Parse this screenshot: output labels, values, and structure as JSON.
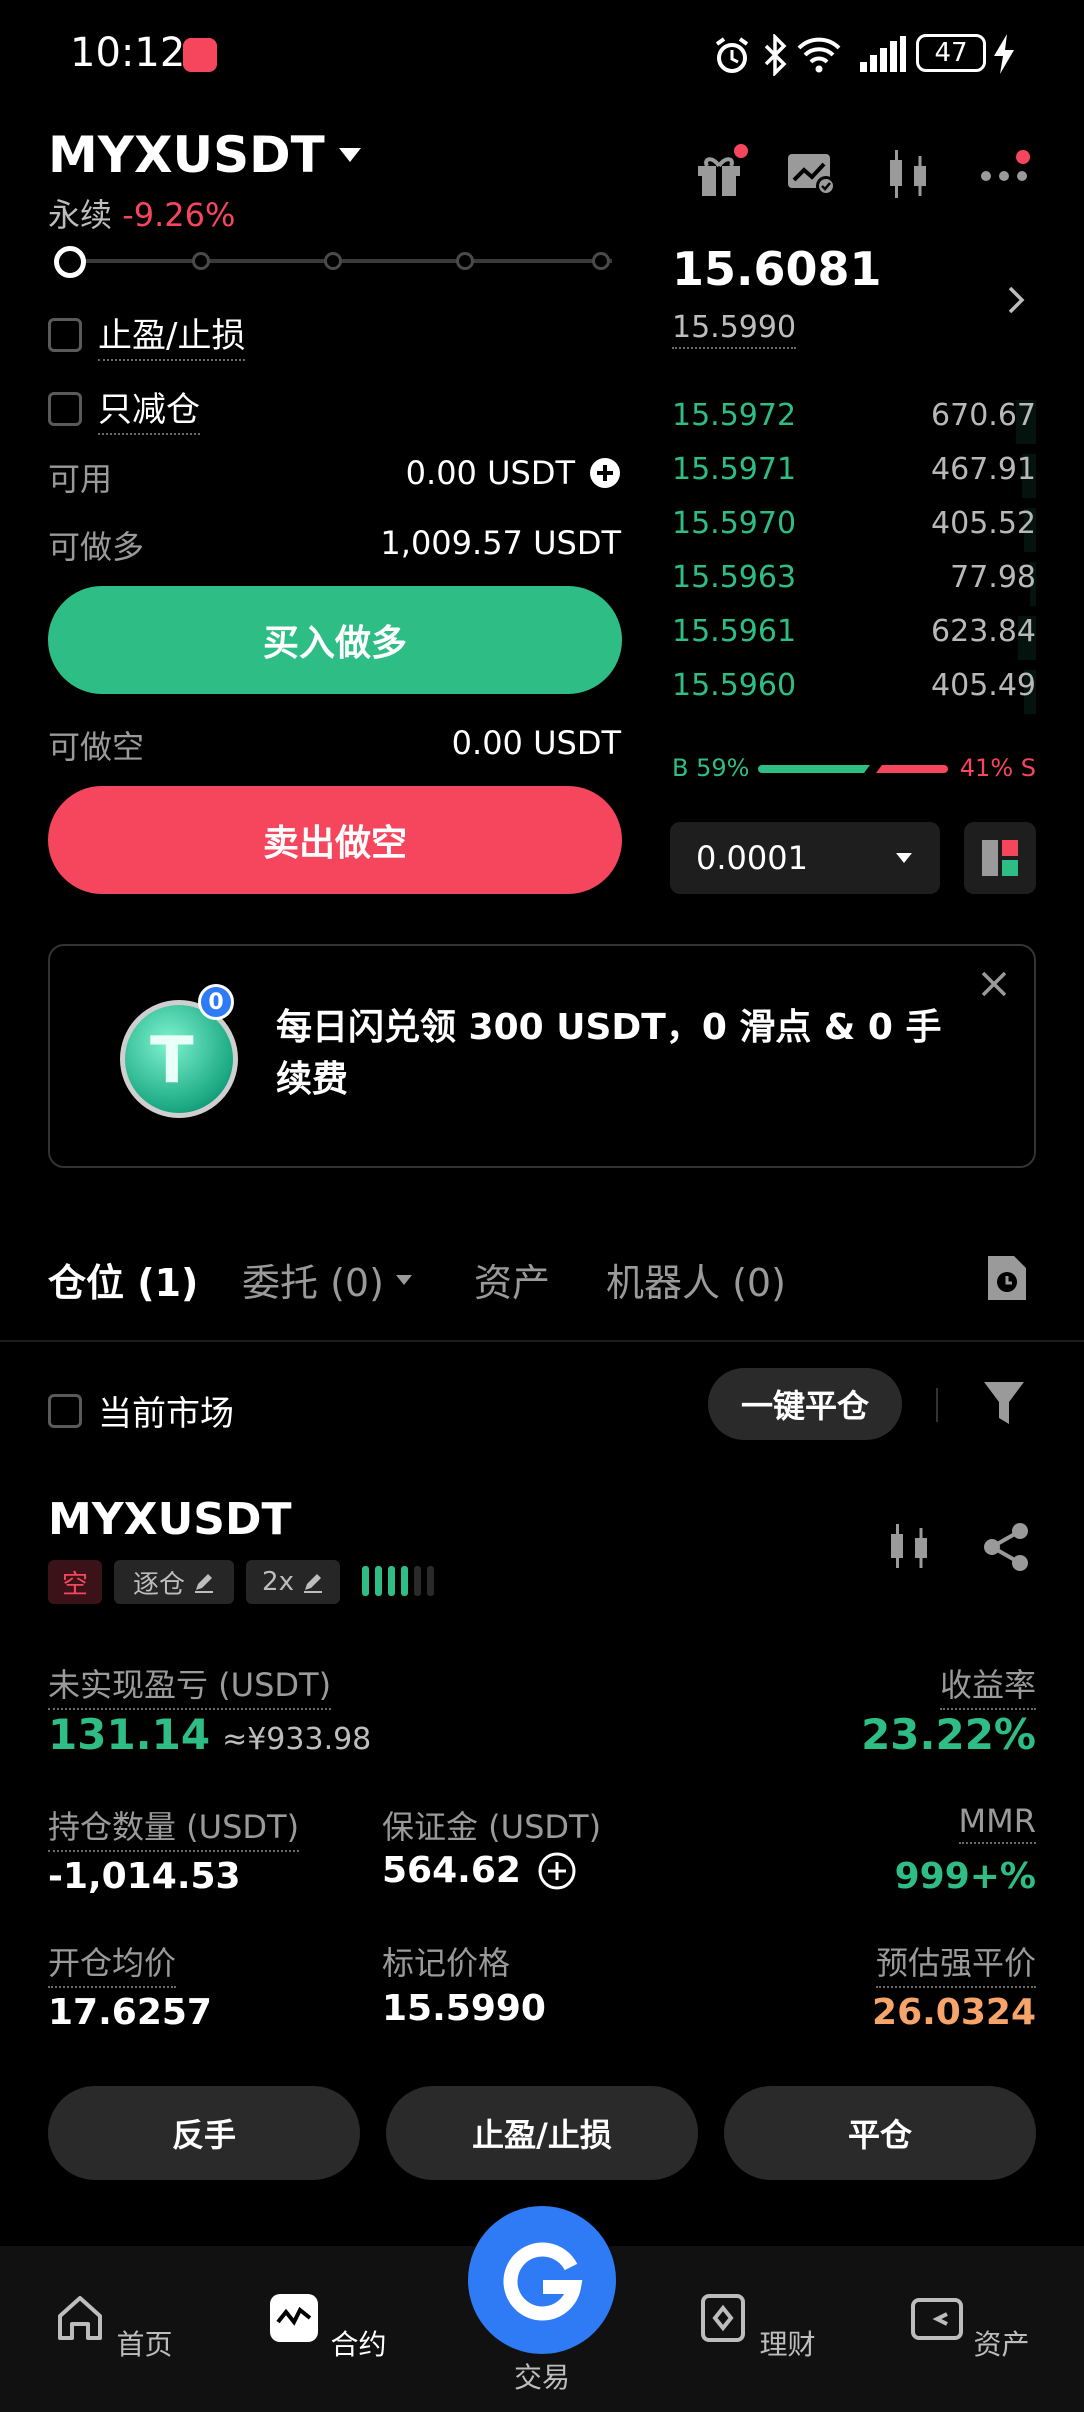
{
  "status_bar": {
    "time": "10:12",
    "battery": "47"
  },
  "header": {
    "symbol": "MYXUSDT",
    "contract_type": "永续",
    "change": "-9.26%"
  },
  "order": {
    "tpsl_label": "止盈/止损",
    "reduce_only_label": "只减仓",
    "available_label": "可用",
    "available_value": "0.00 USDT",
    "max_long_label": "可做多",
    "max_long_value": "1,009.57 USDT",
    "buy_label": "买入做多",
    "max_short_label": "可做空",
    "max_short_value": "0.00 USDT",
    "sell_label": "卖出做空"
  },
  "orderbook": {
    "last_price": "15.6081",
    "mark_price": "15.5990",
    "bids": [
      {
        "price": "15.5972",
        "qty": "670.67"
      },
      {
        "price": "15.5971",
        "qty": "467.91"
      },
      {
        "price": "15.5970",
        "qty": "405.52"
      },
      {
        "price": "15.5963",
        "qty": "77.98"
      },
      {
        "price": "15.5961",
        "qty": "623.84"
      },
      {
        "price": "15.5960",
        "qty": "405.49"
      }
    ],
    "buy_ratio_label": "B 59%",
    "sell_ratio_label": "41% S",
    "buy_ratio": 0.59,
    "precision": "0.0001"
  },
  "banner": {
    "badge": "0",
    "text": "每日闪兑领 300 USDT，0 滑点 & 0 手续费"
  },
  "tabs": {
    "positions": "仓位 (1)",
    "orders": "委托 (0)",
    "assets": "资产",
    "bots": "机器人 (0)"
  },
  "filter": {
    "current_market": "当前市场",
    "close_all": "一键平仓"
  },
  "position": {
    "symbol": "MYXUSDT",
    "side_tag": "空",
    "margin_mode": "逐仓",
    "leverage": "2x",
    "upnl_label": "未实现盈亏 (USDT)",
    "upnl_value": "131.14",
    "upnl_cny": "≈¥933.98",
    "roe_label": "收益率",
    "roe_value": "23.22%",
    "size_label": "持仓数量 (USDT)",
    "size_value": "-1,014.53",
    "margin_label": "保证金 (USDT)",
    "margin_value": "564.62",
    "mmr_label": "MMR",
    "mmr_value": "999+%",
    "entry_label": "开仓均价",
    "entry_value": "17.6257",
    "mark_label": "标记价格",
    "mark_value": "15.5990",
    "liq_label": "预估强平价",
    "liq_value": "26.0324",
    "reverse_btn": "反手",
    "tpsl_btn": "止盈/止损",
    "close_btn": "平仓"
  },
  "bottom_nav": {
    "home": "首页",
    "futures": "合约",
    "trade": "交易",
    "earn": "理财",
    "assets": "资产"
  },
  "colors": {
    "green": "#2ebd85",
    "red": "#f6465d",
    "orange": "#f7a46b",
    "accent": "#2f7bf5"
  }
}
